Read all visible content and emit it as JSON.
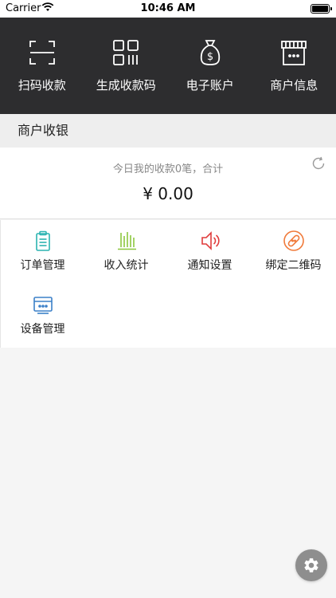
{
  "status_bar": {
    "carrier": "Carrier",
    "time": "10:46 AM"
  },
  "top_nav": [
    {
      "label": "扫码收款",
      "icon": "scan-icon"
    },
    {
      "label": "生成收款码",
      "icon": "qr-code-icon"
    },
    {
      "label": "电子账户",
      "icon": "money-bag-icon"
    },
    {
      "label": "商户信息",
      "icon": "store-icon"
    }
  ],
  "section_title": "商户收银",
  "summary": {
    "description": "今日我的收款0笔，合计",
    "amount": "¥ 0.00"
  },
  "grid": [
    {
      "label": "订单管理",
      "icon": "clipboard-icon",
      "color": "#2bb3b1"
    },
    {
      "label": "收入统计",
      "icon": "bar-stats-icon",
      "color": "#8cc63e"
    },
    {
      "label": "通知设置",
      "icon": "speaker-icon",
      "color": "#e03c3c"
    },
    {
      "label": "绑定二维码",
      "icon": "bandage-icon",
      "color": "#f07a3a"
    },
    {
      "label": "设备管理",
      "icon": "device-icon",
      "color": "#3b80c8"
    }
  ],
  "colors": {
    "topbar_bg": "#2d2d2f",
    "section_bg": "#eeeeee",
    "fab_bg": "#8e8e8e"
  }
}
